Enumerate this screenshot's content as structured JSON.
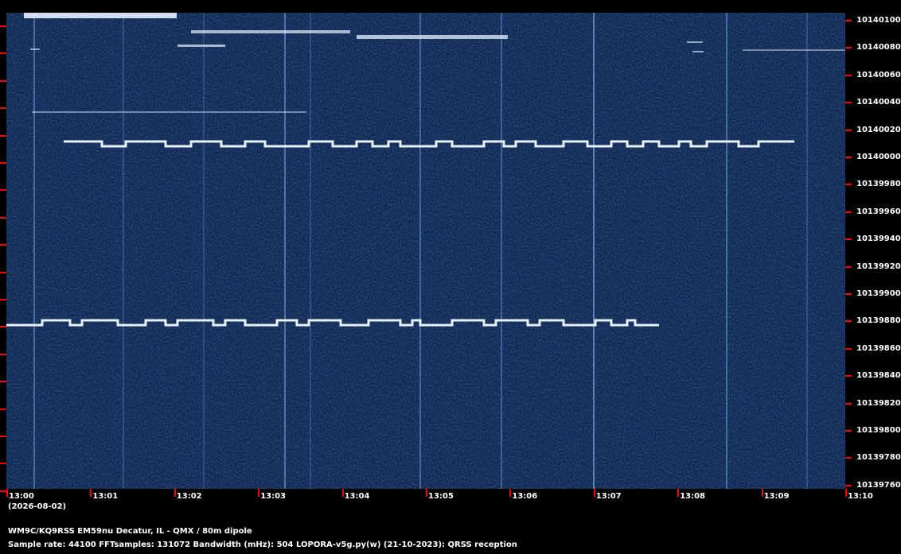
{
  "station_line": "WM9C/KQ9RSS EM59nu Decatur, IL - QMX / 80m dipole",
  "params_line": "Sample rate: 44100    FFTsamples: 131072    Bandwidth (mHz): 504",
  "software_line": "LOPORA-v5g.py(w) (21-10-2023): QRSS reception",
  "date_label": "(2026-08-02)",
  "freq_labels": [
    "10140100",
    "10140080",
    "10140060",
    "10140040",
    "10140020",
    "10140000",
    "10139980",
    "10139960",
    "10139940",
    "10139920",
    "10139900",
    "10139880",
    "10139860",
    "10139840",
    "10139820",
    "10139800",
    "10139780",
    "10139760"
  ],
  "time_labels": [
    "13:00",
    "13:01",
    "13:02",
    "13:03",
    "13:04",
    "13:05",
    "13:06",
    "13:07",
    "13:08",
    "13:09",
    "13:10"
  ],
  "colors": {
    "background": "#000000",
    "spectrogram": "#0c2550",
    "signal": "#ffffff",
    "tick": "#ff0000"
  }
}
